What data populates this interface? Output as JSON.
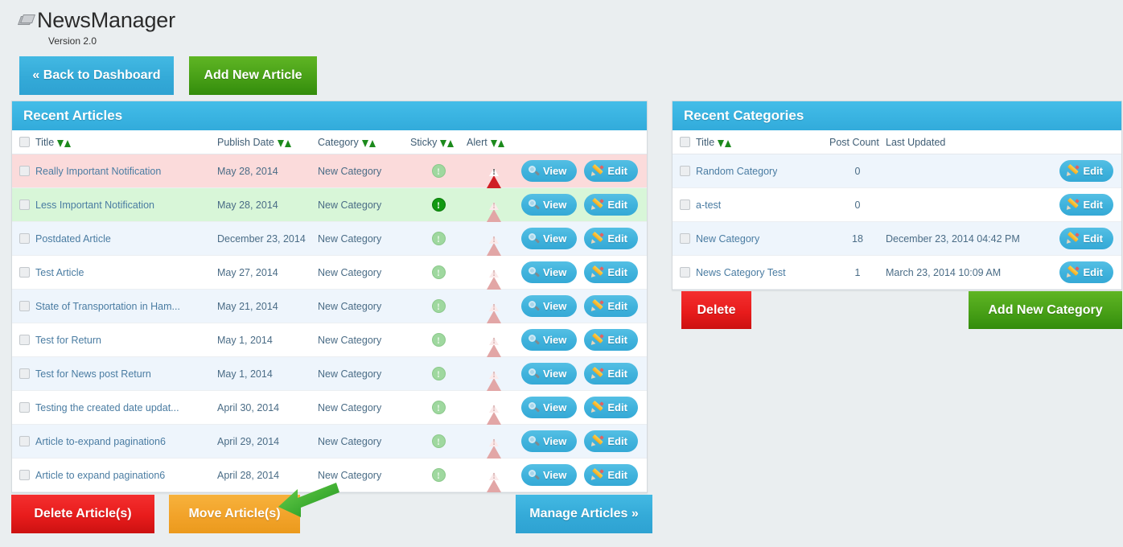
{
  "app": {
    "title": "NewsManager",
    "version": "Version 2.0",
    "logo_icon": "newspaper-icon"
  },
  "toolbar": {
    "back_label": "« Back to Dashboard",
    "add_article_label": "Add New Article"
  },
  "colors": {
    "accent_blue": "#3ab4e2",
    "green": "#48a017",
    "red": "#e81c1c",
    "orange": "#f2a32a",
    "page_bg": "#eaeef0",
    "row_alt": "#eef5fc",
    "row_alert_bg": "#fbdbdb",
    "row_sticky_bg": "#d8f6d8",
    "sort_arrow": "#1c8a1c"
  },
  "articles_panel": {
    "title": "Recent Articles",
    "columns": [
      {
        "label": "Title",
        "sortable": true
      },
      {
        "label": "Publish Date",
        "sortable": true
      },
      {
        "label": "Category",
        "sortable": true
      },
      {
        "label": "Sticky",
        "sortable": true
      },
      {
        "label": "Alert",
        "sortable": true
      },
      {
        "label": "",
        "sortable": false
      }
    ],
    "view_label": "View",
    "edit_label": "Edit",
    "rows": [
      {
        "title": "Really Important Notification",
        "date": "May 28, 2014",
        "category": "New Category",
        "sticky": false,
        "alert": true,
        "highlight": "alert"
      },
      {
        "title": "Less Important Notification",
        "date": "May 28, 2014",
        "category": "New Category",
        "sticky": true,
        "alert": false,
        "highlight": "sticky"
      },
      {
        "title": "Postdated Article",
        "date": "December 23, 2014",
        "category": "New Category",
        "sticky": false,
        "alert": false,
        "highlight": "alt"
      },
      {
        "title": "Test Article",
        "date": "May 27, 2014",
        "category": "New Category",
        "sticky": false,
        "alert": false,
        "highlight": ""
      },
      {
        "title": "State of Transportation in Ham...",
        "date": "May 21, 2014",
        "category": "New Category",
        "sticky": false,
        "alert": false,
        "highlight": "alt"
      },
      {
        "title": "Test for Return",
        "date": "May 1, 2014",
        "category": "New Category",
        "sticky": false,
        "alert": false,
        "highlight": ""
      },
      {
        "title": "Test for News post Return",
        "date": "May 1, 2014",
        "category": "New Category",
        "sticky": false,
        "alert": false,
        "highlight": "alt"
      },
      {
        "title": "Testing the created date updat...",
        "date": "April 30, 2014",
        "category": "New Category",
        "sticky": false,
        "alert": false,
        "highlight": ""
      },
      {
        "title": "Article to-expand pagination6",
        "date": "April 29, 2014",
        "category": "New Category",
        "sticky": false,
        "alert": false,
        "highlight": "alt"
      },
      {
        "title": "Article to expand pagination6",
        "date": "April 28, 2014",
        "category": "New Category",
        "sticky": false,
        "alert": false,
        "highlight": ""
      }
    ],
    "footer_buttons": {
      "delete_label": "Delete Article(s)",
      "move_label": "Move Article(s)",
      "manage_label": "Manage Articles »"
    }
  },
  "categories_panel": {
    "title": "Recent Categories",
    "columns": [
      {
        "label": "Title",
        "sortable": true
      },
      {
        "label": "Post Count",
        "sortable": false
      },
      {
        "label": "Last Updated",
        "sortable": false
      },
      {
        "label": "",
        "sortable": false
      }
    ],
    "edit_label": "Edit",
    "rows": [
      {
        "title": "Random Category",
        "post_count": "0",
        "last_updated": "",
        "highlight": "alt"
      },
      {
        "title": "a-test",
        "post_count": "0",
        "last_updated": "",
        "highlight": ""
      },
      {
        "title": "New Category",
        "post_count": "18",
        "last_updated": "December 23, 2014 04:42 PM",
        "highlight": "alt"
      },
      {
        "title": "News Category Test",
        "post_count": "1",
        "last_updated": "March 23, 2014 10:09 AM",
        "highlight": ""
      }
    ],
    "footer_buttons": {
      "delete_label": "Delete",
      "add_label": "Add New Category"
    }
  },
  "annotation": {
    "arrow": "green-arrow-pointing-to-move-articles"
  }
}
